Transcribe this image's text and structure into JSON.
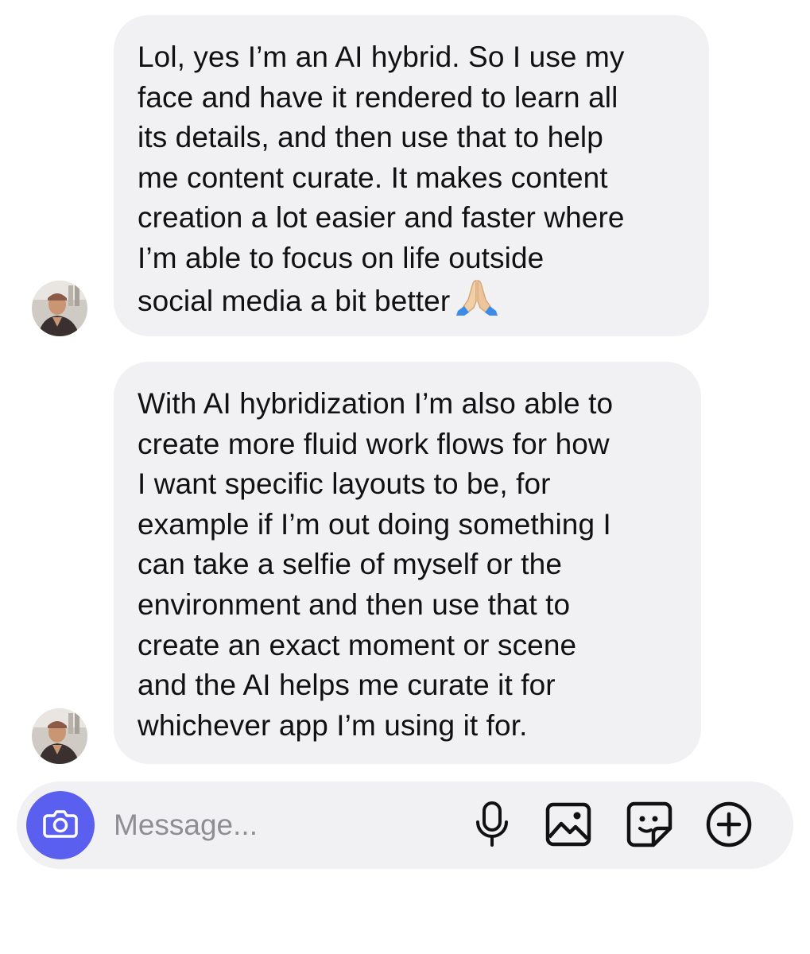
{
  "thread": {
    "messages": [
      {
        "lines": [
          "Lol, yes I’m an AI hybrid. So I use my",
          "face and have it rendered to learn all",
          "its details, and then use that to help",
          "me content curate. It makes content",
          "creation a lot easier and faster where",
          "I’m able to focus on life outside",
          "social media a bit better"
        ],
        "emoji": "folded-hands-emoji"
      },
      {
        "lines": [
          "With AI hybridization I’m also able to",
          "create more fluid work flows for how",
          "I want specific layouts to be, for",
          "example if I’m out doing something I",
          "can take a selfie of myself or the",
          "environment and then use that to",
          "create an exact moment or scene",
          "and the AI helps me curate it for",
          "whichever app I’m using it for."
        ]
      }
    ]
  },
  "composer": {
    "placeholder": "Message...",
    "value": "",
    "icons": {
      "camera": "camera-icon",
      "mic": "microphone-icon",
      "gallery": "image-icon",
      "sticker": "sticker-icon",
      "plus": "plus-circle-icon"
    }
  },
  "colors": {
    "bubble": "#f1f1f4",
    "composer": "#f1f1f4",
    "camera_button": "#5a5ff0",
    "placeholder": "#8e8e93",
    "text": "#111111"
  }
}
